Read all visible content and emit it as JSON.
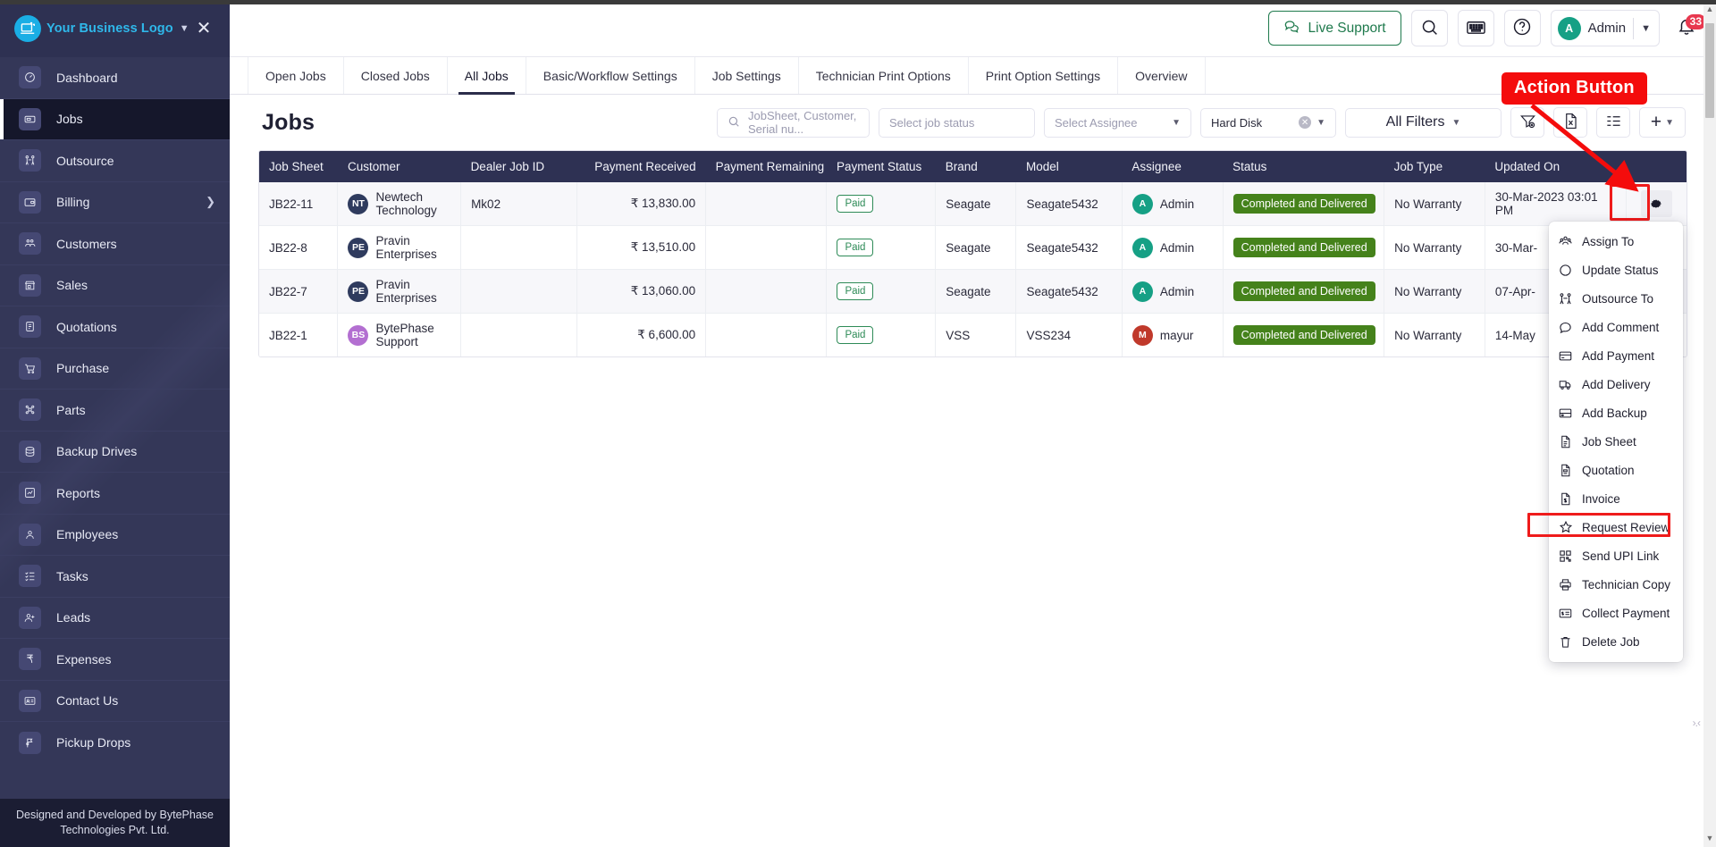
{
  "sidebar": {
    "brand": {
      "name": "Your Business Logo",
      "caret": "chevron-down",
      "close": "✕"
    },
    "items": [
      {
        "label": "Dashboard",
        "icon": "dashboard-icon",
        "active": false,
        "chevron": false
      },
      {
        "label": "Jobs",
        "icon": "jobs-icon",
        "active": true,
        "chevron": false
      },
      {
        "label": "Outsource",
        "icon": "outsource-icon",
        "active": false,
        "chevron": false
      },
      {
        "label": "Billing",
        "icon": "billing-icon",
        "active": false,
        "chevron": true
      },
      {
        "label": "Customers",
        "icon": "customers-icon",
        "active": false,
        "chevron": false
      },
      {
        "label": "Sales",
        "icon": "sales-icon",
        "active": false,
        "chevron": false
      },
      {
        "label": "Quotations",
        "icon": "quotations-icon",
        "active": false,
        "chevron": false
      },
      {
        "label": "Purchase",
        "icon": "purchase-icon",
        "active": false,
        "chevron": false
      },
      {
        "label": "Parts",
        "icon": "parts-icon",
        "active": false,
        "chevron": false
      },
      {
        "label": "Backup Drives",
        "icon": "backup-drives-icon",
        "active": false,
        "chevron": false
      },
      {
        "label": "Reports",
        "icon": "reports-icon",
        "active": false,
        "chevron": false
      },
      {
        "label": "Employees",
        "icon": "employees-icon",
        "active": false,
        "chevron": false
      },
      {
        "label": "Tasks",
        "icon": "tasks-icon",
        "active": false,
        "chevron": false
      },
      {
        "label": "Leads",
        "icon": "leads-icon",
        "active": false,
        "chevron": false
      },
      {
        "label": "Expenses",
        "icon": "expenses-icon",
        "active": false,
        "chevron": false
      },
      {
        "label": "Contact Us",
        "icon": "contact-us-icon",
        "active": false,
        "chevron": false
      },
      {
        "label": "Pickup Drops",
        "icon": "pickup-drops-icon",
        "active": false,
        "chevron": false
      }
    ],
    "footer": "Designed and Developed by BytePhase Technologies Pvt. Ltd."
  },
  "topbar": {
    "live_support": "Live Support",
    "search_icon": "search-icon",
    "keyboard_icon": "keyboard-icon",
    "help_icon": "help-circle-icon",
    "user_initial": "A",
    "user_name": "Admin",
    "notification_count": "33"
  },
  "tabs": [
    {
      "label": "Open Jobs",
      "active": false
    },
    {
      "label": "Closed Jobs",
      "active": false
    },
    {
      "label": "All Jobs",
      "active": true
    },
    {
      "label": "Basic/Workflow Settings",
      "active": false
    },
    {
      "label": "Job Settings",
      "active": false
    },
    {
      "label": "Technician Print Options",
      "active": false
    },
    {
      "label": "Print Option Settings",
      "active": false
    },
    {
      "label": "Overview",
      "active": false
    }
  ],
  "panel": {
    "title": "Jobs",
    "search_placeholder": "JobSheet, Customer, Serial nu...",
    "status_placeholder": "Select job status",
    "assignee_placeholder": "Select Assignee",
    "hard_disk_value": "Hard Disk",
    "all_filters_label": "All Filters",
    "clear_filter_icon": "filter-clear-icon",
    "excel_icon": "excel-export-icon",
    "columns_icon": "column-settings-icon",
    "add_label": "+"
  },
  "table": {
    "columns": [
      "Job Sheet",
      "Customer",
      "Dealer Job ID",
      "Payment Received",
      "Payment Remaining",
      "Payment Status",
      "Brand",
      "Model",
      "Assignee",
      "Status",
      "Job Type",
      "Updated On",
      ""
    ],
    "rows": [
      {
        "job_sheet": "JB22-11",
        "customer": "Newtech Technology",
        "customer_initials": "NT",
        "customer_color": "#2f3b5e",
        "dealer_job_id": "Mk02",
        "payment_received": "₹ 13,830.00",
        "payment_remaining": "",
        "payment_status": "Paid",
        "brand": "Seagate",
        "model": "Seagate5432",
        "assignee": "Admin",
        "assignee_initial": "A",
        "assignee_color": "#16a085",
        "status": "Completed and Delivered",
        "job_type": "No Warranty",
        "updated_on": "30-Mar-2023 03:01 PM"
      },
      {
        "job_sheet": "JB22-8",
        "customer": "Pravin Enterprises",
        "customer_initials": "PE",
        "customer_color": "#2f3b5e",
        "dealer_job_id": "",
        "payment_received": "₹ 13,510.00",
        "payment_remaining": "",
        "payment_status": "Paid",
        "brand": "Seagate",
        "model": "Seagate5432",
        "assignee": "Admin",
        "assignee_initial": "A",
        "assignee_color": "#16a085",
        "status": "Completed and Delivered",
        "job_type": "No Warranty",
        "updated_on": "30-Mar-"
      },
      {
        "job_sheet": "JB22-7",
        "customer": "Pravin Enterprises",
        "customer_initials": "PE",
        "customer_color": "#2f3b5e",
        "dealer_job_id": "",
        "payment_received": "₹ 13,060.00",
        "payment_remaining": "",
        "payment_status": "Paid",
        "brand": "Seagate",
        "model": "Seagate5432",
        "assignee": "Admin",
        "assignee_initial": "A",
        "assignee_color": "#16a085",
        "status": "Completed and Delivered",
        "job_type": "No Warranty",
        "updated_on": "07-Apr-"
      },
      {
        "job_sheet": "JB22-1",
        "customer": "BytePhase Support",
        "customer_initials": "BS",
        "customer_color": "#b36fd1",
        "dealer_job_id": "",
        "payment_received": "₹ 6,600.00",
        "payment_remaining": "",
        "payment_status": "Paid",
        "brand": "VSS",
        "model": "VSS234",
        "assignee": "mayur",
        "assignee_initial": "M",
        "assignee_color": "#c0392b",
        "status": "Completed and Delivered",
        "job_type": "No Warranty",
        "updated_on": "14-May"
      }
    ]
  },
  "action_menu": {
    "items": [
      {
        "label": "Assign To",
        "icon": "assign-to-icon",
        "highlighted": false
      },
      {
        "label": "Update Status",
        "icon": "update-status-icon",
        "highlighted": false
      },
      {
        "label": "Outsource To",
        "icon": "outsource-to-icon",
        "highlighted": false
      },
      {
        "label": "Add Comment",
        "icon": "comment-icon",
        "highlighted": false
      },
      {
        "label": "Add Payment",
        "icon": "card-icon",
        "highlighted": false
      },
      {
        "label": "Add Delivery",
        "icon": "truck-icon",
        "highlighted": false
      },
      {
        "label": "Add Backup",
        "icon": "backup-icon",
        "highlighted": false
      },
      {
        "label": "Job Sheet",
        "icon": "document-icon",
        "highlighted": false
      },
      {
        "label": "Quotation",
        "icon": "quotation-doc-icon",
        "highlighted": false
      },
      {
        "label": "Invoice",
        "icon": "invoice-icon",
        "highlighted": false
      },
      {
        "label": "Request Review",
        "icon": "star-icon",
        "highlighted": true
      },
      {
        "label": "Send UPI Link",
        "icon": "qr-code-icon",
        "highlighted": false
      },
      {
        "label": "Technician Copy",
        "icon": "printer-icon",
        "highlighted": false
      },
      {
        "label": "Collect Payment",
        "icon": "collect-payment-icon",
        "highlighted": false
      },
      {
        "label": "Delete Job",
        "icon": "trash-icon",
        "highlighted": false
      }
    ]
  },
  "annotations": {
    "action_button_label": "Action Button",
    "highlight_color": "#f40c0c"
  }
}
